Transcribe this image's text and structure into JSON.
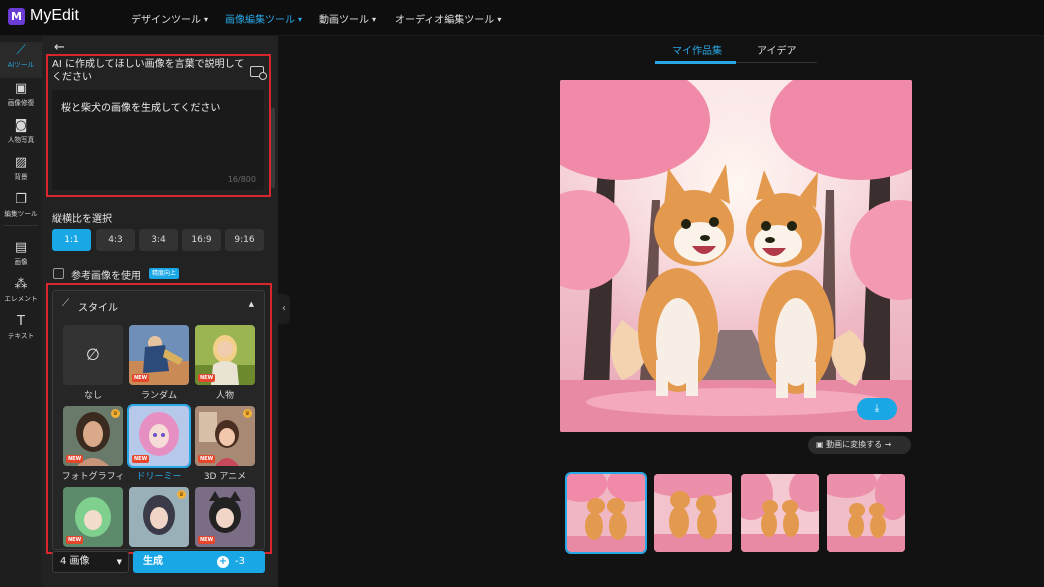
{
  "app": {
    "name": "MyEdit",
    "logo_letter": "M"
  },
  "nav": {
    "items": [
      {
        "label": "デザインツール"
      },
      {
        "label": "画像編集ツール",
        "active": true
      },
      {
        "label": "動画ツール"
      },
      {
        "label": "オーディオ編集ツール"
      }
    ]
  },
  "rail": {
    "items": [
      {
        "label": "AIツール",
        "icon": "magic-wand-icon",
        "active": true
      },
      {
        "label": "画像修復",
        "icon": "image-repair-icon"
      },
      {
        "label": "人物写真",
        "icon": "portrait-icon"
      },
      {
        "label": "背景",
        "icon": "background-icon"
      },
      {
        "label": "編集ツール",
        "icon": "edit-tools-icon"
      },
      {
        "label": "画像",
        "icon": "image-icon"
      },
      {
        "label": "エレメント",
        "icon": "elements-icon"
      },
      {
        "label": "テキスト",
        "icon": "text-icon"
      }
    ]
  },
  "panel": {
    "prompt_label": "AI に作成してほしい画像を言葉で説明してください",
    "prompt_value": "桜と柴犬の画像を生成してください",
    "char_count": "16/800",
    "ratio_label": "縦横比を選択",
    "ratios": [
      {
        "label": "1:1",
        "active": true
      },
      {
        "label": "4:3"
      },
      {
        "label": "3:4"
      },
      {
        "label": "16:9"
      },
      {
        "label": "9:16"
      }
    ],
    "reference_label": "参考画像を使用",
    "reference_badge": "精度向上",
    "style_title": "スタイル",
    "styles": [
      {
        "label": "なし",
        "none_symbol": "∅"
      },
      {
        "label": "ランダム",
        "new": "NEW"
      },
      {
        "label": "人物",
        "new": "NEW"
      },
      {
        "label": "フォトグラフィ",
        "new": "NEW",
        "premium": true
      },
      {
        "label": "ドリーミー",
        "new": "NEW",
        "selected": true
      },
      {
        "label": "3D アニメ",
        "new": "NEW",
        "premium": true
      },
      {
        "label": "",
        "new": "NEW"
      },
      {
        "label": "",
        "premium": true
      },
      {
        "label": "",
        "new": "NEW"
      }
    ],
    "count_value": "4 画像",
    "generate_label": "生成",
    "credit_cost": "-3"
  },
  "gallery": {
    "tabs": [
      {
        "label": "マイ作品集",
        "active": true
      },
      {
        "label": "アイデア"
      }
    ],
    "convert_video_label": "動画に変換する",
    "thumbnail_count": 4
  },
  "colors": {
    "accent": "#1aa7e6",
    "highlight_frame": "#d8262e",
    "badge_new": "#e5462c"
  }
}
